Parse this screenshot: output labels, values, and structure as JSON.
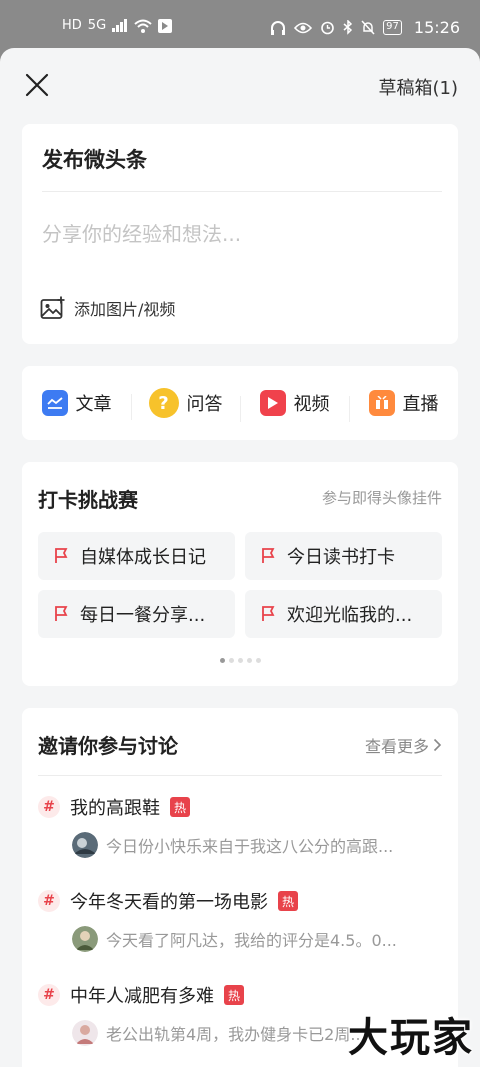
{
  "status_bar": {
    "hd": "HD",
    "network": "5G",
    "battery": "97",
    "time": "15:26"
  },
  "header": {
    "draft_label": "草稿箱(1)"
  },
  "compose": {
    "title": "发布微头条",
    "placeholder": "分享你的经验和想法...",
    "add_media_label": "添加图片/视频"
  },
  "post_types": [
    {
      "label": "文章",
      "icon": "article-icon",
      "color": "#3d7bf2"
    },
    {
      "label": "问答",
      "icon": "question-icon",
      "color": "#f7c22b"
    },
    {
      "label": "视频",
      "icon": "video-icon",
      "color": "#f0424c"
    },
    {
      "label": "直播",
      "icon": "live-icon",
      "color": "#ff8a3d"
    }
  ],
  "challenge": {
    "title": "打卡挑战赛",
    "subtitle": "参与即得头像挂件",
    "items": [
      {
        "label": "自媒体成长日记"
      },
      {
        "label": "今日读书打卡"
      },
      {
        "label": "每日一餐分享..."
      },
      {
        "label": "欢迎光临我的..."
      }
    ],
    "pages": 5,
    "active_page": 1
  },
  "discuss": {
    "title": "邀请你参与讨论",
    "more_label": "查看更多",
    "topics": [
      {
        "title": "我的高跟鞋",
        "badge": "热",
        "preview": "今日份小快乐来自于我这八公分的高跟..."
      },
      {
        "title": "今年冬天看的第一场电影",
        "badge": "热",
        "preview": "今天看了阿凡达，我给的评分是4.5。0..."
      },
      {
        "title": "中年人减肥有多难",
        "badge": "热",
        "preview": "老公出轨第4周，我办健身卡已2周..."
      }
    ]
  },
  "watermark": "大玩家",
  "colors": {
    "accent_red": "#e8434b",
    "background": "#f4f5f6",
    "card": "#ffffff"
  }
}
